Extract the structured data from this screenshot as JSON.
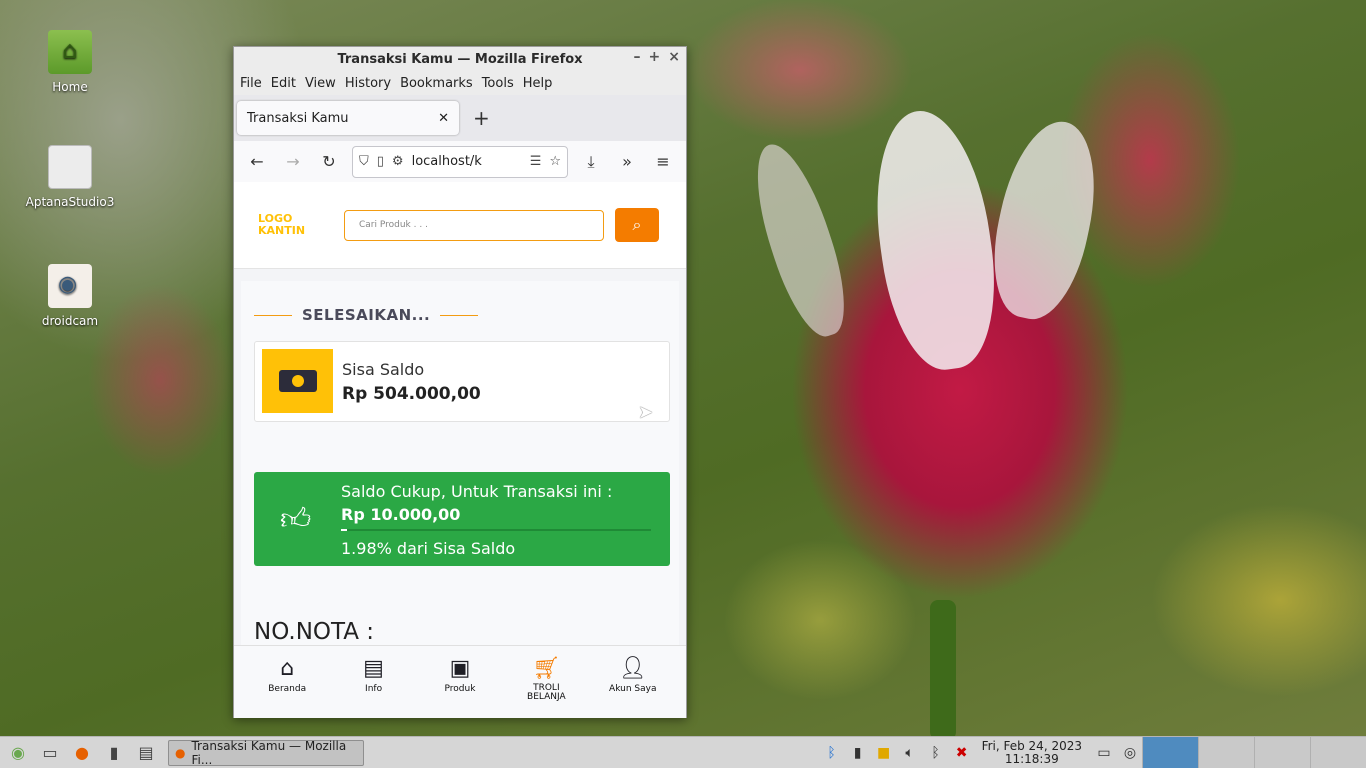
{
  "desktop": {
    "icons": [
      {
        "label": "Home",
        "icon": "home-folder-icon"
      },
      {
        "label": "AptanaStudio3",
        "icon": "aptana-icon"
      },
      {
        "label": "droidcam",
        "icon": "droidcam-eye-icon"
      }
    ]
  },
  "window": {
    "title": "Transaksi Kamu — Mozilla Firefox",
    "menu": [
      "File",
      "Edit",
      "View",
      "History",
      "Bookmarks",
      "Tools",
      "Help"
    ],
    "tab_title": "Transaksi Kamu",
    "url": "localhost/k"
  },
  "page": {
    "logo_line1": "LOGO",
    "logo_line2": "KANTIN",
    "search_placeholder": "Cari Produk . . .",
    "section_title": "SELESAIKAN...",
    "saldo_label": "Sisa Saldo",
    "saldo_value": "Rp 504.000,00",
    "ok_label": "Saldo Cukup, Untuk Transaksi ini :",
    "ok_value": "Rp 10.000,00",
    "ok_percent_text": "1.98% dari Sisa Saldo",
    "ok_percent": 1.98,
    "nota_label": "NO.NOTA :",
    "bottom_nav": [
      {
        "label": "Beranda",
        "icon": "home-icon"
      },
      {
        "label": "Info",
        "icon": "newspaper-icon"
      },
      {
        "label": "Produk",
        "icon": "archive-box-icon"
      },
      {
        "label": "TROLI BELANJA",
        "icon": "cart-icon",
        "active": true
      },
      {
        "label": "Akun Saya",
        "icon": "user-icon"
      }
    ],
    "accent_color": "#f47c00",
    "success_color": "#2ba845",
    "logo_color": "#ffc107"
  },
  "taskbar": {
    "task_label": "Transaksi Kamu — Mozilla Fi...",
    "clock_date": "Fri, Feb 24, 2023",
    "clock_time": "11:18:39"
  }
}
